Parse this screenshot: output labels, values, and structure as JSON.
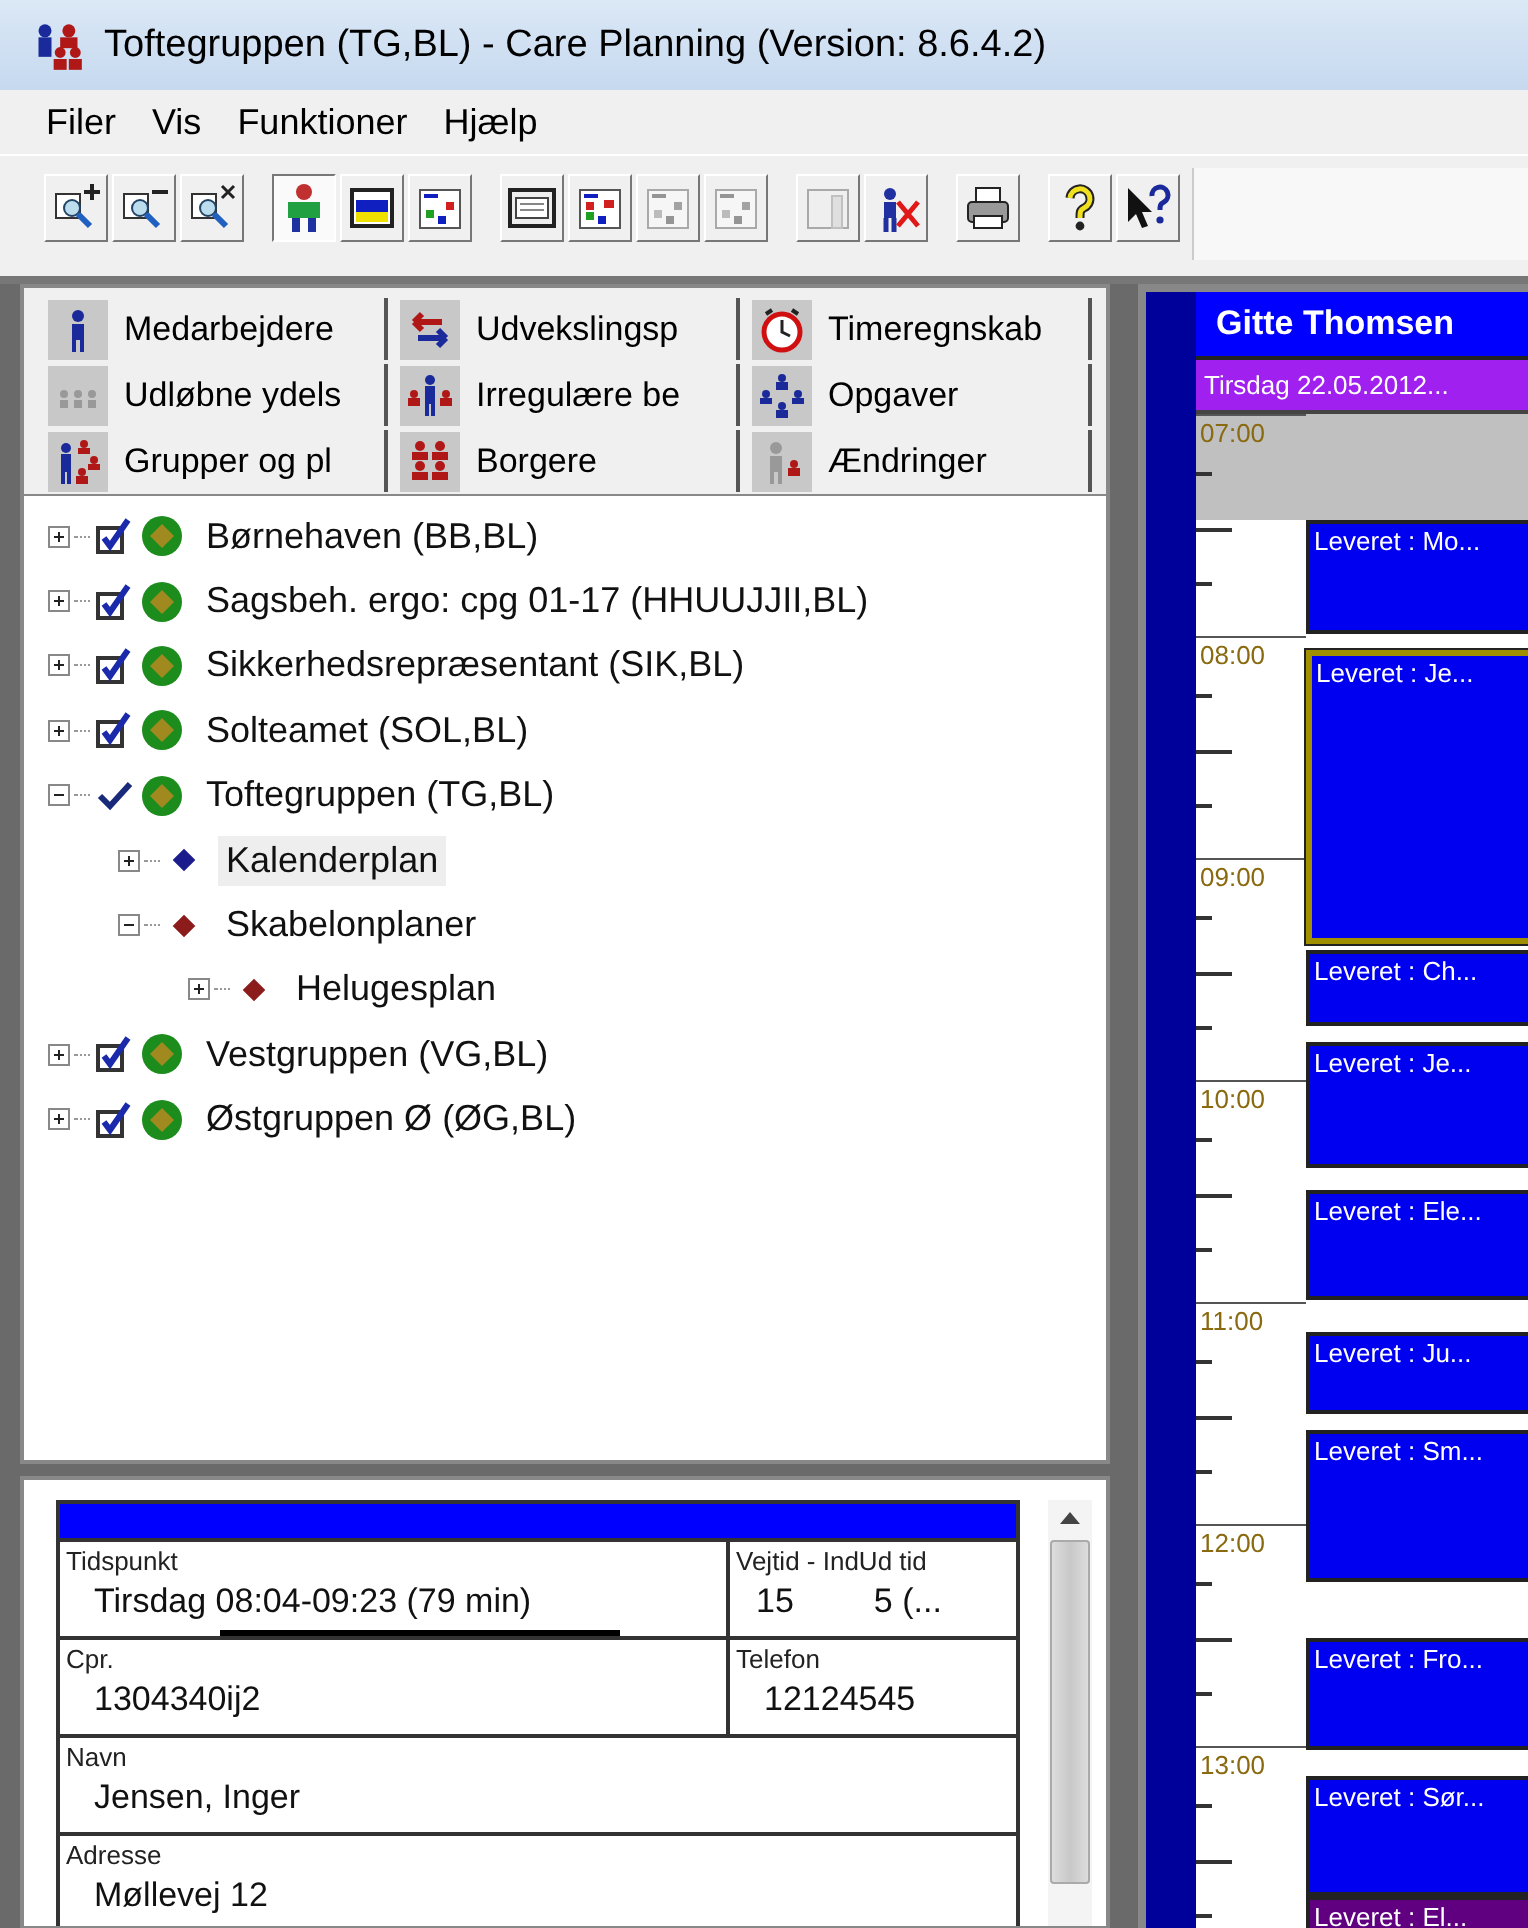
{
  "window": {
    "title": "Toftegruppen (TG,BL) - Care Planning (Version: 8.6.4.2)"
  },
  "menu": [
    "Filer",
    "Vis",
    "Funktioner",
    "Hjælp"
  ],
  "toolbar": [
    {
      "kind": "zoom-in",
      "pressed": false,
      "disabled": false
    },
    {
      "kind": "zoom-out",
      "pressed": false,
      "disabled": false
    },
    {
      "kind": "zoom-reset",
      "pressed": false,
      "disabled": false
    },
    {
      "kind": "person",
      "pressed": true,
      "disabled": false
    },
    {
      "kind": "window",
      "pressed": false,
      "disabled": false
    },
    {
      "kind": "squares",
      "pressed": false,
      "disabled": false
    },
    {
      "kind": "calendar",
      "pressed": false,
      "disabled": false
    },
    {
      "kind": "squares-red",
      "pressed": false,
      "disabled": false
    },
    {
      "kind": "squares",
      "pressed": false,
      "disabled": true
    },
    {
      "kind": "squares",
      "pressed": false,
      "disabled": true
    },
    {
      "kind": "columns",
      "pressed": false,
      "disabled": true
    },
    {
      "kind": "person-cross",
      "pressed": false,
      "disabled": false
    },
    {
      "kind": "printer",
      "pressed": false,
      "disabled": false
    },
    {
      "kind": "help",
      "pressed": false,
      "disabled": false
    },
    {
      "kind": "help-pointer",
      "pressed": false,
      "disabled": false
    }
  ],
  "nav_buttons": [
    {
      "label": "Medarbejdere",
      "kind": "person"
    },
    {
      "label": "Udvekslingsp",
      "kind": "exchange"
    },
    {
      "label": "Timeregnskab",
      "kind": "clock"
    },
    {
      "label": "Udløbne ydels",
      "kind": "people-gray"
    },
    {
      "label": "Irregulære be",
      "kind": "people-mixed"
    },
    {
      "label": "Opgaver",
      "kind": "org-chart"
    },
    {
      "label": "Grupper og pl",
      "kind": "groups"
    },
    {
      "label": "Borgere",
      "kind": "people-red"
    },
    {
      "label": "Ændringer",
      "kind": "person-gray"
    }
  ],
  "tree": [
    {
      "label": "Børnehaven (BB,BL)",
      "kind": "group",
      "expanded": false,
      "selected": false
    },
    {
      "label": "Sagsbeh. ergo: cpg 01-17 (HHUUJJII,BL)",
      "kind": "group",
      "expanded": false,
      "selected": false
    },
    {
      "label": "Sikkerhedsrepræsentant (SIK,BL)",
      "kind": "group",
      "expanded": false,
      "selected": false
    },
    {
      "label": "Solteamet (SOL,BL)",
      "kind": "group",
      "expanded": false,
      "selected": false
    },
    {
      "label": "Toftegruppen (TG,BL)",
      "kind": "active-group",
      "expanded": true,
      "selected": false,
      "children": [
        {
          "label": "Kalenderplan",
          "kind": "plan",
          "color": "#1c1c8c",
          "expanded": false,
          "selected": true
        },
        {
          "label": "Skabelonplaner",
          "kind": "plan",
          "color": "#8c1c1c",
          "expanded": true,
          "selected": false,
          "children": [
            {
              "label": "Helugesplan",
              "kind": "plan",
              "color": "#8c1c1c",
              "expanded": false,
              "selected": false
            }
          ]
        }
      ]
    },
    {
      "label": "Vestgruppen (VG,BL)",
      "kind": "group",
      "expanded": false,
      "selected": false
    },
    {
      "label": "Østgruppen Ø (ØG,BL)",
      "kind": "group",
      "expanded": false,
      "selected": false
    }
  ],
  "details": {
    "rows": [
      [
        {
          "label": "Tidspunkt",
          "value": "Tirsdag 08:04-09:23 (79 min)"
        },
        {
          "label": "Vejtid - IndUd tid",
          "values": [
            "15",
            "5 (..."
          ]
        }
      ],
      [
        {
          "label": "Cpr.",
          "value": "1304340ij2"
        },
        {
          "label": "Telefon",
          "value": "12124545"
        }
      ],
      [
        {
          "label": "Navn",
          "value": "Jensen, Inger"
        }
      ],
      [
        {
          "label": "Adresse",
          "value": "Møllevej 12"
        }
      ]
    ]
  },
  "calendar": {
    "person": "Gitte Thomsen",
    "date": "Tirsdag 22.05.2012...",
    "hours": [
      "07:00",
      "08:00",
      "09:00",
      "10:00",
      "11:00",
      "12:00",
      "13:00"
    ],
    "events": [
      {
        "text": "Leveret : Mo...",
        "kind": "delivered",
        "selected": false
      },
      {
        "text": "Leveret : Je...",
        "kind": "delivered",
        "selected": true
      },
      {
        "text": "Leveret : Ch...",
        "kind": "delivered",
        "selected": false
      },
      {
        "text": "Leveret : Je...",
        "kind": "delivered",
        "selected": false
      },
      {
        "text": "Leveret : Ele...",
        "kind": "delivered",
        "selected": false
      },
      {
        "text": "Leveret : Ju...",
        "kind": "delivered",
        "selected": false
      },
      {
        "text": "Leveret : Sm...",
        "kind": "delivered",
        "selected": false
      },
      {
        "text": "Leveret : Fro...",
        "kind": "delivered",
        "selected": false
      },
      {
        "text": "Leveret : Sør...",
        "kind": "delivered",
        "selected": false
      },
      {
        "text": "Leveret : El...",
        "kind": "other",
        "selected": false
      }
    ]
  }
}
